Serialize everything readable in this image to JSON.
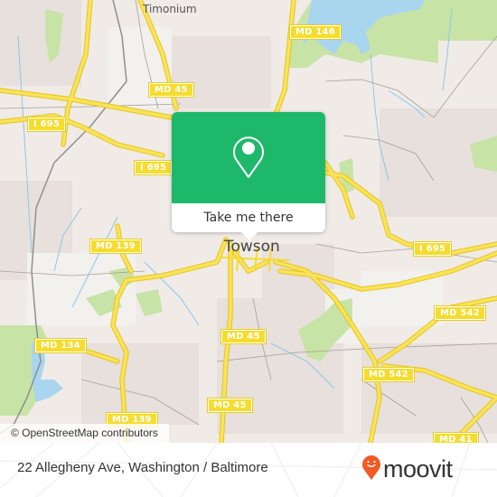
{
  "map": {
    "place_labels": {
      "town": "Towson",
      "suburb": "Timonium"
    },
    "road_shields": [
      {
        "id": "md146",
        "label": "MD 146"
      },
      {
        "id": "md45-north",
        "label": "MD 45"
      },
      {
        "id": "i695-west",
        "label": "I 695"
      },
      {
        "id": "i695-center",
        "label": "I 695"
      },
      {
        "id": "md139-north",
        "label": "MD 139"
      },
      {
        "id": "i695-east",
        "label": "I 695"
      },
      {
        "id": "md542-east",
        "label": "MD 542"
      },
      {
        "id": "md45-center",
        "label": "MD 45"
      },
      {
        "id": "md134",
        "label": "MD 134"
      },
      {
        "id": "md542-south",
        "label": "MD 542"
      },
      {
        "id": "md45-south",
        "label": "MD 45"
      },
      {
        "id": "md139-south",
        "label": "MD 139"
      },
      {
        "id": "md41",
        "label": "MD 41"
      }
    ],
    "colors": {
      "land": "#f0ebe7",
      "residential": "#e6dfdb",
      "park": "#c8e3a6",
      "water": "#a9d5ee",
      "road_major": "#f5dc2e",
      "road_minor": "#a89f9a"
    }
  },
  "popup": {
    "icon": "map-pin-icon",
    "button_label": "Take me there",
    "color": "#1eb86b"
  },
  "attribution": "© OpenStreetMap contributors",
  "footer": {
    "address": "22 Allegheny Ave, Washington / Baltimore",
    "logo_text": "moovit",
    "logo_icon": "moovit-pin-icon",
    "logo_color": "#f15a24"
  }
}
